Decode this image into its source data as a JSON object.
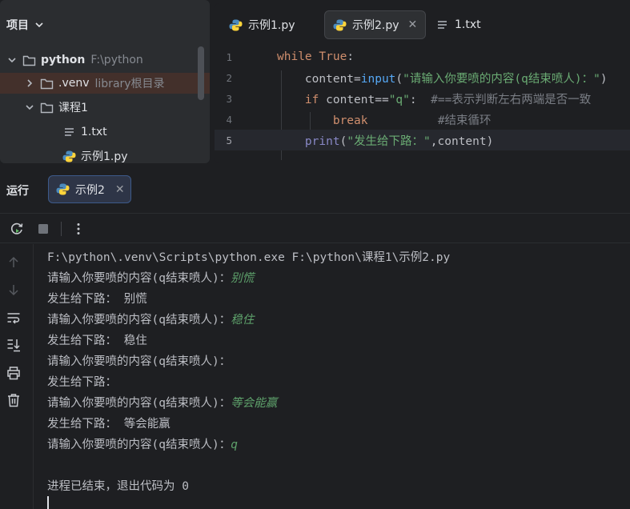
{
  "project": {
    "title": "项目",
    "tree": [
      {
        "name": "python",
        "hint": "F:\\python",
        "kind": "root"
      },
      {
        "name": ".venv",
        "hint": "library根目录",
        "kind": "folder"
      },
      {
        "name": "课程1",
        "hint": "",
        "kind": "folder"
      },
      {
        "name": "1.txt",
        "hint": "",
        "kind": "text"
      },
      {
        "name": "示例1.py",
        "hint": "",
        "kind": "python"
      }
    ]
  },
  "editor": {
    "tabs": [
      {
        "label": "示例1.py",
        "active": false
      },
      {
        "label": "示例2.py",
        "active": true
      },
      {
        "label": "1.txt",
        "active": false
      }
    ],
    "line_numbers": [
      "1",
      "2",
      "3",
      "4",
      "5"
    ],
    "current_line": "5",
    "code": {
      "l1_kw": "while",
      "l1_const": "True",
      "l1_colon": ":",
      "l2_var": "content",
      "l2_eq": "=",
      "l2_fn": "input",
      "l2_str": "\"请输入你要喷的内容(q结束喷人)：\"",
      "l2_close": ")",
      "l2_open": "(",
      "l3_kw": "if",
      "l3_expr": "content==",
      "l3_str": "\"q\"",
      "l3_colon": ":",
      "l3_comment": "#==表示判断左右两端是否一致",
      "l4_kw": "break",
      "l4_comment": "#结束循环",
      "l5_fn": "print",
      "l5_open": "(",
      "l5_str": "\"发生给下路：\"",
      "l5_rest": ",content",
      "l5_close": ")"
    }
  },
  "run": {
    "title": "运行",
    "tab_label": "示例2",
    "console": [
      {
        "text": "F:\\python\\.venv\\Scripts\\python.exe F:\\python\\课程1\\示例2.py",
        "input": ""
      },
      {
        "text": "请输入你要喷的内容(q结束喷人)：",
        "input": "别慌"
      },
      {
        "text": "发生给下路： 别慌",
        "input": ""
      },
      {
        "text": "请输入你要喷的内容(q结束喷人)：",
        "input": "稳住"
      },
      {
        "text": "发生给下路： 稳住",
        "input": ""
      },
      {
        "text": "请输入你要喷的内容(q结束喷人)：",
        "input": ""
      },
      {
        "text": "发生给下路：",
        "input": ""
      },
      {
        "text": "请输入你要喷的内容(q结束喷人)：",
        "input": "等会能赢"
      },
      {
        "text": "发生给下路： 等会能赢",
        "input": ""
      },
      {
        "text": "请输入你要喷的内容(q结束喷人)：",
        "input": "q"
      },
      {
        "text": "",
        "input": ""
      },
      {
        "text": "进程已结束，退出代码为 0",
        "input": ""
      }
    ]
  },
  "colors": {
    "keyword": "#cf8e6d",
    "function": "#56a8f5",
    "string": "#6aab73",
    "comment": "#7a7e85",
    "user_input": "#5ea16b",
    "selected_row": "#43302b"
  }
}
